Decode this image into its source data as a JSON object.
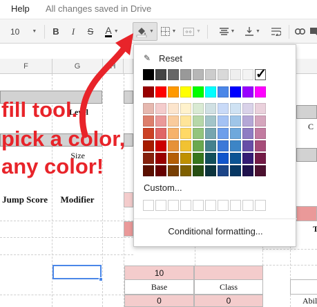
{
  "menubar": {
    "help": "Help",
    "saved_status": "All changes saved in Drive"
  },
  "toolbar": {
    "font_size": "10",
    "bold": "B",
    "italic": "I",
    "strikethrough": "S",
    "text_color": "A",
    "icons": [
      "bold-icon",
      "italic-icon",
      "strikethrough-icon",
      "text-color-icon",
      "fill-color-icon",
      "borders-icon",
      "merge-cells-icon",
      "horizontal-align-icon",
      "vertical-align-icon",
      "text-wrap-icon",
      "link-icon",
      "comment-icon"
    ]
  },
  "columns": [
    "F",
    "G",
    "H"
  ],
  "cells": {
    "level": "Level",
    "size": "Size",
    "jump_score": "Jump Score",
    "modifier": "Modifier",
    "ten": "10",
    "base": "Base",
    "class": "Class",
    "zero_a": "0",
    "zero_b": "0",
    "c_partial": "C",
    "t_partial": "T",
    "abil_partial": "Abil"
  },
  "annotation": {
    "line1": "fill tool.",
    "line2": "pick a color,",
    "line3": "any color!",
    "color": "#e8242a"
  },
  "color_picker": {
    "reset": "Reset",
    "custom": "Custom...",
    "conditional": "Conditional formatting...",
    "selected_color": "#ffffff",
    "gray_row": [
      "#000000",
      "#434343",
      "#666666",
      "#999999",
      "#b7b7b7",
      "#cccccc",
      "#d9d9d9",
      "#efefef",
      "#f3f3f3",
      "#ffffff"
    ],
    "bright_row": [
      "#980000",
      "#ff0000",
      "#ff9900",
      "#ffff00",
      "#00ff00",
      "#00ffff",
      "#4a86e8",
      "#0000ff",
      "#9900ff",
      "#ff00ff"
    ],
    "shade_rows": [
      [
        "#e6b8af",
        "#f4cccc",
        "#fce5cd",
        "#fff2cc",
        "#d9ead3",
        "#d0e0e3",
        "#c9daf8",
        "#cfe2f3",
        "#d9d2e9",
        "#ead1dc"
      ],
      [
        "#dd7e6b",
        "#ea9999",
        "#f9cb9c",
        "#ffe599",
        "#b6d7a8",
        "#a2c4c9",
        "#a4c2f4",
        "#9fc5e8",
        "#b4a7d6",
        "#d5a6bd"
      ],
      [
        "#cc4125",
        "#e06666",
        "#f6b26b",
        "#ffd966",
        "#93c47d",
        "#76a5af",
        "#6d9eeb",
        "#6fa8dc",
        "#8e7cc3",
        "#c27ba0"
      ],
      [
        "#a61c00",
        "#cc0000",
        "#e69138",
        "#f1c232",
        "#6aa84f",
        "#45818e",
        "#3c78d8",
        "#3d85c6",
        "#674ea7",
        "#a64d79"
      ],
      [
        "#85200c",
        "#990000",
        "#b45f06",
        "#bf9000",
        "#38761d",
        "#134f5c",
        "#1155cc",
        "#0b5394",
        "#351c75",
        "#741b47"
      ],
      [
        "#5b0f00",
        "#660000",
        "#783f04",
        "#7f6000",
        "#274e13",
        "#0c343d",
        "#1c4587",
        "#073763",
        "#20124d",
        "#4c1130"
      ]
    ],
    "custom_slots": 10
  }
}
